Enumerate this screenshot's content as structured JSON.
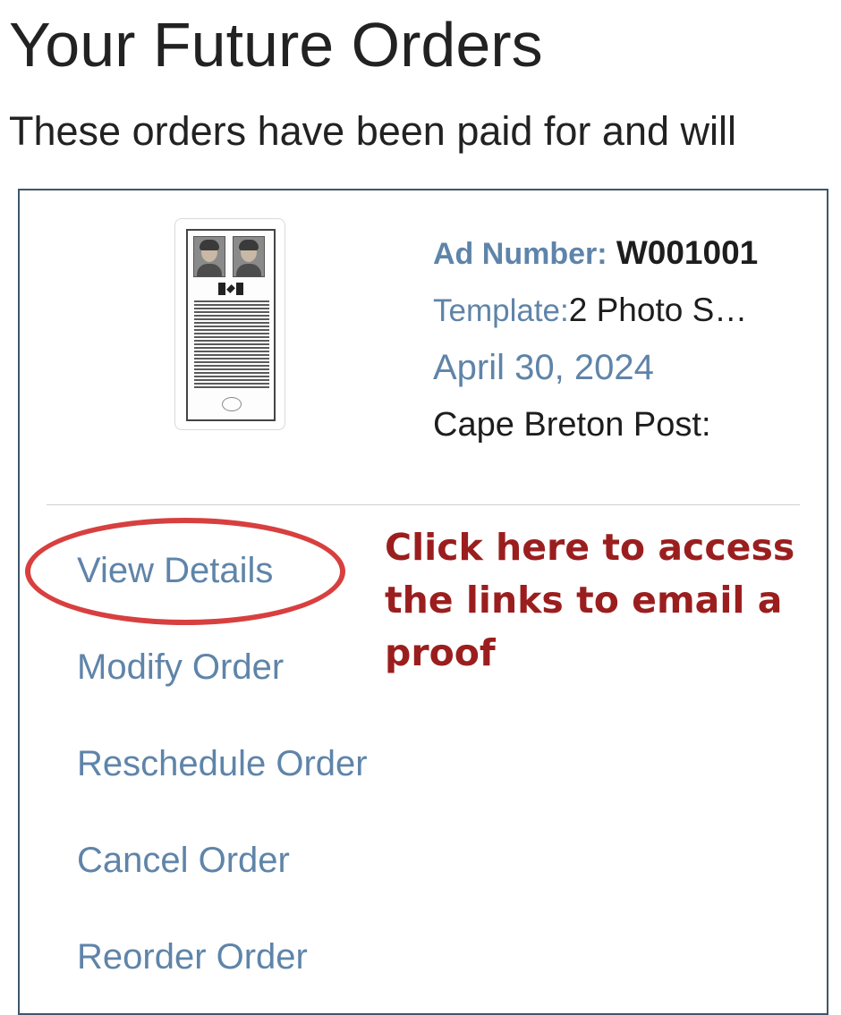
{
  "page": {
    "title": "Your Future Orders",
    "intro": "These orders have been paid for and will"
  },
  "order": {
    "ad_number_label": "Ad Number:",
    "ad_number_value": "W001001",
    "template_label": "Template:",
    "template_value": "2 Photo S…",
    "date": "April 30, 2024",
    "publication": "Cape Breton Post:"
  },
  "actions": {
    "view_details": "View Details",
    "modify_order": "Modify Order",
    "reschedule_order": "Reschedule Order",
    "cancel_order": "Cancel Order",
    "reorder_order": "Reorder Order"
  },
  "annotation": {
    "callout_text": "Click here to access the links to email a proof",
    "ring_color": "#d83f3f",
    "text_color": "#9b1e1e"
  },
  "colors": {
    "link": "#5f84a9",
    "card_border": "#3f5668"
  }
}
